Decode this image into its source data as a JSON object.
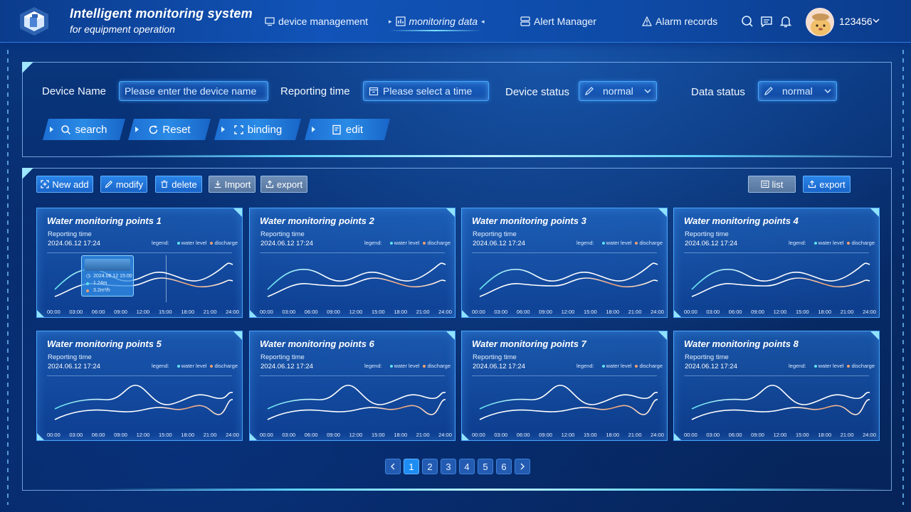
{
  "header": {
    "title_line1": "Intelligent monitoring system",
    "title_line2": "for equipment operation",
    "nav": [
      {
        "label": "device management",
        "icon": "monitor-icon"
      },
      {
        "label": "monitoring data",
        "icon": "chart-icon",
        "active": true
      },
      {
        "label": "Alert Manager",
        "icon": "list-icon"
      },
      {
        "label": "Alarm records",
        "icon": "warning-icon"
      }
    ],
    "username": "123456"
  },
  "filters": {
    "device_name_label": "Device Name",
    "device_name_placeholder": "Please enter the device name",
    "reporting_time_label": "Reporting time",
    "reporting_time_placeholder": "Please select a time",
    "device_status_label": "Device status",
    "device_status_value": "normal",
    "data_status_label": "Data status",
    "data_status_value": "normal",
    "buttons": {
      "search": "search",
      "reset": "Reset",
      "binding": "binding",
      "edit": "edit"
    }
  },
  "toolbar": {
    "new_add": "New add",
    "modify": "modify",
    "delete": "delete",
    "import": "Import",
    "export": "export",
    "list": "list",
    "export_right": "export"
  },
  "card_common": {
    "reporting_time_label": "Reporting time",
    "date": "2024.06.12 17:24",
    "legend_label": "legend:",
    "legend_water": "water level",
    "legend_discharge": "discharge",
    "x_ticks": [
      "00:00",
      "03:00",
      "06:00",
      "09:00",
      "12:00",
      "15:00",
      "18:00",
      "21:00",
      "24:00"
    ]
  },
  "cards": [
    {
      "title": "Water monitoring points 1"
    },
    {
      "title": "Water monitoring points 2"
    },
    {
      "title": "Water monitoring points 3"
    },
    {
      "title": "Water monitoring points 4"
    },
    {
      "title": "Water monitoring points 5"
    },
    {
      "title": "Water monitoring points 6"
    },
    {
      "title": "Water monitoring points 7"
    },
    {
      "title": "Water monitoring points 8"
    }
  ],
  "tooltip": {
    "time": "2024.06.12 15:00",
    "water_level": "1.24m",
    "discharge": "3.2m³/h"
  },
  "pagination": {
    "pages": [
      "1",
      "2",
      "3",
      "4",
      "5",
      "6"
    ],
    "current": "1"
  },
  "colors": {
    "water_level": "#5fe0f0",
    "discharge": "#f0a070",
    "accent": "#4aa5ff"
  }
}
